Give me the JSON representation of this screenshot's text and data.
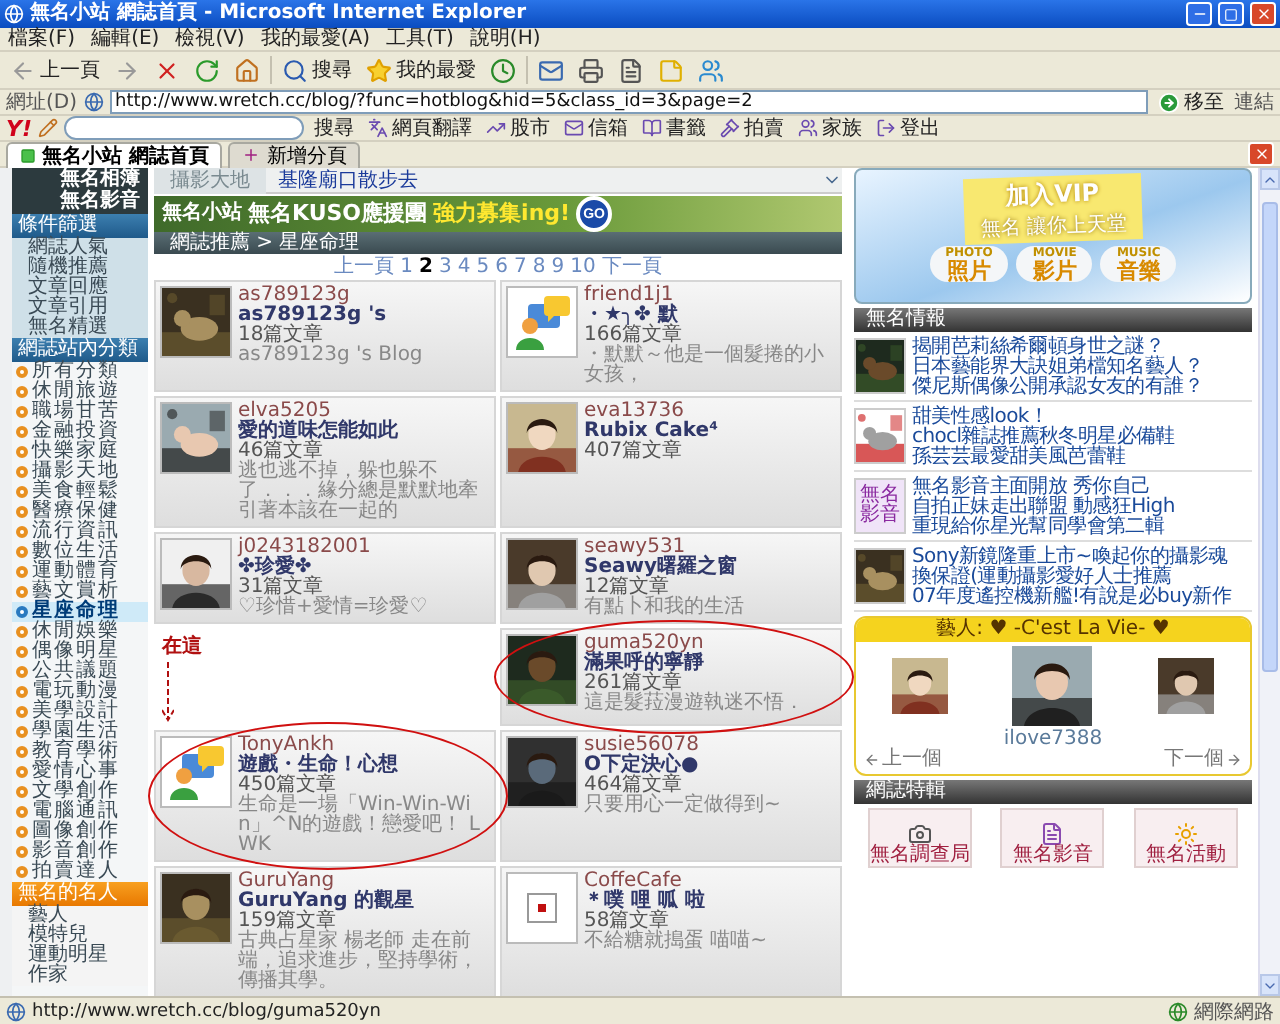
{
  "window": {
    "title": "無名小站 網誌首頁 - Microsoft Internet Explorer"
  },
  "menu": [
    "檔案(F)",
    "編輯(E)",
    "檢視(V)",
    "我的最愛(A)",
    "工具(T)",
    "說明(H)"
  ],
  "toolbar": {
    "back": "上一頁",
    "search": "搜尋",
    "favorites": "我的最愛"
  },
  "address": {
    "label": "網址(D)",
    "url": "http://www.wretch.cc/blog/?func=hotblog&hid=5&class_id=3&page=2",
    "go": "移至",
    "links": "連結"
  },
  "yahoo_toolbar": {
    "logo": "Y!",
    "search_button": "搜尋",
    "items": [
      {
        "label": "網頁翻譯"
      },
      {
        "label": "股市"
      },
      {
        "label": "信箱"
      },
      {
        "label": "書籤"
      },
      {
        "label": "拍賣"
      },
      {
        "label": "家族"
      },
      {
        "label": "登出"
      }
    ]
  },
  "browser_tabs": [
    {
      "label": "無名小站 網誌首頁",
      "selected": true
    }
  ],
  "new_tab": "新增分頁",
  "sidebar": {
    "top_links": [
      "無名相簿",
      "無名影音"
    ],
    "sections": [
      {
        "title": "條件篩選",
        "kind": "plain",
        "items": [
          {
            "label": "網誌人氣",
            "selected": false
          },
          {
            "label": "隨機推薦",
            "selected": false
          },
          {
            "label": "文章回應",
            "selected": false
          },
          {
            "label": "文章引用",
            "selected": false
          },
          {
            "label": "無名精選",
            "selected": false
          }
        ]
      },
      {
        "title": "網誌站內分類",
        "kind": "bullets",
        "items": [
          {
            "label": "所有分類",
            "selected": false
          },
          {
            "label": "休閒旅遊",
            "selected": false
          },
          {
            "label": "職場甘苦",
            "selected": false
          },
          {
            "label": "金融投資",
            "selected": false
          },
          {
            "label": "快樂家庭",
            "selected": false
          },
          {
            "label": "攝影天地",
            "selected": false
          },
          {
            "label": "美食輕鬆",
            "selected": false
          },
          {
            "label": "醫療保健",
            "selected": false
          },
          {
            "label": "流行資訊",
            "selected": false
          },
          {
            "label": "數位生活",
            "selected": false
          },
          {
            "label": "運動體育",
            "selected": false
          },
          {
            "label": "藝文賞析",
            "selected": false
          },
          {
            "label": "星座命理",
            "selected": true
          },
          {
            "label": "休閒娛樂",
            "selected": false
          },
          {
            "label": "偶像明星",
            "selected": false
          },
          {
            "label": "公共議題",
            "selected": false
          },
          {
            "label": "電玩動漫",
            "selected": false
          },
          {
            "label": "美學設計",
            "selected": false
          },
          {
            "label": "學園生活",
            "selected": false
          },
          {
            "label": "教育學術",
            "selected": false
          },
          {
            "label": "愛情心事",
            "selected": false
          },
          {
            "label": "文學創作",
            "selected": false
          },
          {
            "label": "電腦通訊",
            "selected": false
          },
          {
            "label": "圖像創作",
            "selected": false
          },
          {
            "label": "影音創作",
            "selected": false
          },
          {
            "label": "拍賣達人",
            "selected": false
          }
        ]
      },
      {
        "title": "無名的名人",
        "kind": "orange",
        "items": [
          {
            "label": "藝人",
            "selected": false
          },
          {
            "label": "模特兒",
            "selected": false
          },
          {
            "label": "運動明星",
            "selected": false
          },
          {
            "label": "作家",
            "selected": false
          }
        ]
      }
    ]
  },
  "center": {
    "channel": {
      "tab": "攝影大地",
      "headline": "基隆廟口散步去"
    },
    "banner": {
      "logo": "無名小站",
      "text": "無名KUSO應援團",
      "highlight": "強力募集ing!",
      "button": "GO"
    },
    "breadcrumb": "網誌推薦 > 星座命理",
    "pagination": {
      "prev": "上一頁",
      "next": "下一頁",
      "pages": [
        {
          "label": "1",
          "selected": false
        },
        {
          "label": "2",
          "selected": true
        },
        {
          "label": "3",
          "selected": false
        },
        {
          "label": "4",
          "selected": false
        },
        {
          "label": "5",
          "selected": false
        },
        {
          "label": "6",
          "selected": false
        },
        {
          "label": "7",
          "selected": false
        },
        {
          "label": "8",
          "selected": false
        },
        {
          "label": "9",
          "selected": false
        },
        {
          "label": "10",
          "selected": false
        }
      ]
    },
    "note": "在這",
    "cards": [
      {
        "kind": "blog",
        "user": "as789123g",
        "title": "as789123g 's",
        "count": "18篇文章",
        "description": "as789123g 's Blog"
      },
      {
        "kind": "blog",
        "user": "friend1j1",
        "title": "・★╮✤ 默",
        "count": "166篇文章",
        "description": "・默默～他是一個髮捲的小女孩，"
      },
      {
        "kind": "blog",
        "user": "elva5205",
        "title": "愛的道味怎能如此",
        "count": "46篇文章",
        "description": "逃也逃不掉，躲也躲不了．．．緣分總是默默地牽引著本該在一起的"
      },
      {
        "kind": "blog",
        "user": "eva13736",
        "title": "Rubix Cake⁴",
        "count": "407篇文章"
      },
      {
        "kind": "blog",
        "user": "j0243182001",
        "title": "✤珍愛✤",
        "count": "31篇文章",
        "description": "♡珍惜+愛情=珍愛♡"
      },
      {
        "kind": "blog",
        "user": "seawy531",
        "title": "Seawy曙羅之窗",
        "count": "12篇文章",
        "description": "有點卜和我的生活"
      },
      {
        "kind": "blank"
      },
      {
        "kind": "blog",
        "annotated": true,
        "user": "guma520yn",
        "title": "滿果呼的寧靜",
        "count": "261篇文章",
        "description": "這是髮菈漫遊執迷不悟．"
      },
      {
        "kind": "blog",
        "annotated": true,
        "user": "TonyAnkh",
        "title": "遊戲・生命！心想",
        "count": "450篇文章",
        "description": "生命是一場「Win-Win-Win」^N的遊戲！戀愛吧！ LWK"
      },
      {
        "kind": "blog",
        "user": "susie56078",
        "title": "O下定決心●",
        "count": "464篇文章",
        "description": "只要用心一定做得到~"
      },
      {
        "kind": "blog",
        "user": "GuruYang",
        "title": "GuruYang 的觀星",
        "count": "159篇文章",
        "description": "古典占星家 楊老師 走在前端，追求進步，堅持學術，傳播其學。"
      },
      {
        "kind": "blog",
        "user": "CoffeCafe",
        "title": "＊噗 哩 呱 啦",
        "count": "58篇文章",
        "description": "不給糖就搗蛋 喵喵~"
      }
    ]
  },
  "right": {
    "vip": {
      "title": "加入VIP",
      "slogan": "無名 讓你上天堂",
      "items": [
        {
          "tag": "PHOTO",
          "label": "照片"
        },
        {
          "tag": "MOVIE",
          "label": "影片"
        },
        {
          "tag": "MUSIC",
          "label": "音樂"
        }
      ]
    },
    "news_title": "無名情報",
    "news": [
      {
        "thumb": {
          "kind": "picture"
        },
        "lines": [
          "揭開芭莉絲希爾頓身世之謎？",
          "日本藝能界大訣姐弟檔知名藝人？",
          "傑尼斯偶像公開承認女友的有誰？"
        ]
      },
      {
        "thumb": {
          "kind": "picture"
        },
        "lines": [
          "甜美性感look！",
          "chocl雜誌推薦秋冬明星必備鞋",
          "孫芸芸最愛甜美風芭蕾鞋"
        ]
      },
      {
        "thumb": {
          "kind": "badge",
          "label": "無名影音"
        },
        "lines": [
          "無名影音主面開放 秀你自己",
          "自拍正妹走出聯盟 動感狂High",
          "重現給你星光幫同學會第二輯"
        ]
      },
      {
        "thumb": {
          "kind": "picture"
        },
        "lines": [
          "Sony新鏡隆重上市~喚起你的攝影魂",
          "換保證(運動攝影愛好人士推薦",
          "07年度遙控機新艦!有說是必buy新作"
        ]
      }
    ],
    "artist": {
      "title": "藝人: ♥ -C'est La Vie- ♥",
      "name": "ilove7388",
      "prev": "上一個",
      "next": "下一個"
    },
    "special": {
      "title": "網誌特輯",
      "items": [
        "無名調查局",
        "無名影音",
        "無名活動"
      ]
    }
  },
  "status_bar": {
    "text": "http://www.wretch.cc/blog/guma520yn",
    "zone": "網際網路"
  }
}
